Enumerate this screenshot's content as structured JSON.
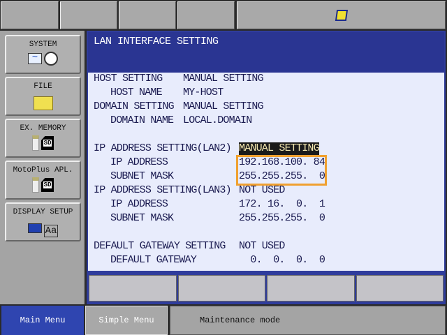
{
  "top_bar": {
    "status_icon": "robot-edit-icon",
    "colors": {
      "bar": "#a9a9a9",
      "icon": "#f0e030"
    }
  },
  "sidebar": {
    "items": [
      {
        "label": "SYSTEM",
        "icon": "system-wave-clock-icon"
      },
      {
        "label": "FILE",
        "icon": "folder-icon"
      },
      {
        "label": "EX. MEMORY",
        "icon": "usb-sd-icon"
      },
      {
        "label": "MotoPlus APL.",
        "icon": "usb-sd-icon"
      },
      {
        "label": "DISPLAY SETUP",
        "icon": "display-font-icon"
      }
    ],
    "sd_label": "SD",
    "font_label": "Aa"
  },
  "screen": {
    "title": "LAN INTERFACE SETTING",
    "rows": [
      {
        "label": "HOST SETTING",
        "value": "MANUAL SETTING"
      },
      {
        "label": "HOST NAME",
        "value": "MY-HOST"
      },
      {
        "label": "DOMAIN SETTING",
        "value": "MANUAL SETTING"
      },
      {
        "label": "DOMAIN NAME",
        "value": "LOCAL.DOMAIN"
      },
      {
        "label": "IP ADDRESS SETTING(LAN2)",
        "value": "MANUAL SETTING"
      },
      {
        "label": "IP ADDRESS",
        "value": "192.168.100. 84"
      },
      {
        "label": "SUBNET MASK",
        "value": "255.255.255.  0"
      },
      {
        "label": "IP ADDRESS SETTING(LAN3)",
        "value": "NOT USED"
      },
      {
        "label": "IP ADDRESS",
        "value": "172. 16.  0.  1"
      },
      {
        "label": "SUBNET MASK",
        "value": "255.255.255.  0"
      },
      {
        "label": "DEFAULT GATEWAY SETTING",
        "value": "NOT USED"
      },
      {
        "label": "DEFAULT GATEWAY",
        "value": "  0.  0.  0.  0"
      }
    ],
    "colors": {
      "background": "#e8ecfc",
      "title_bar": "#2a3592",
      "highlight_border": "#f0a030"
    }
  },
  "bottom": {
    "main_menu": "Main Menu",
    "simple_menu": "Simple Menu",
    "status": "Maintenance mode",
    "colors": {
      "main_menu": "#2f45b0"
    }
  }
}
